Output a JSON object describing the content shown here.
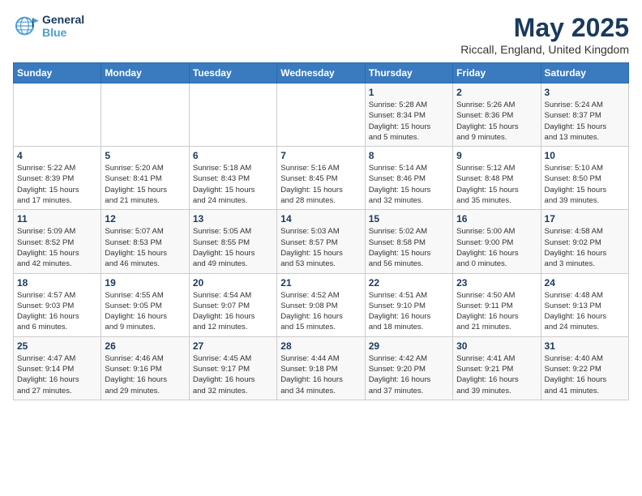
{
  "logo": {
    "line1": "General",
    "line2": "Blue"
  },
  "title": "May 2025",
  "subtitle": "Riccall, England, United Kingdom",
  "weekdays": [
    "Sunday",
    "Monday",
    "Tuesday",
    "Wednesday",
    "Thursday",
    "Friday",
    "Saturday"
  ],
  "weeks": [
    [
      {
        "day": "",
        "info": ""
      },
      {
        "day": "",
        "info": ""
      },
      {
        "day": "",
        "info": ""
      },
      {
        "day": "",
        "info": ""
      },
      {
        "day": "1",
        "info": "Sunrise: 5:28 AM\nSunset: 8:34 PM\nDaylight: 15 hours\nand 5 minutes."
      },
      {
        "day": "2",
        "info": "Sunrise: 5:26 AM\nSunset: 8:36 PM\nDaylight: 15 hours\nand 9 minutes."
      },
      {
        "day": "3",
        "info": "Sunrise: 5:24 AM\nSunset: 8:37 PM\nDaylight: 15 hours\nand 13 minutes."
      }
    ],
    [
      {
        "day": "4",
        "info": "Sunrise: 5:22 AM\nSunset: 8:39 PM\nDaylight: 15 hours\nand 17 minutes."
      },
      {
        "day": "5",
        "info": "Sunrise: 5:20 AM\nSunset: 8:41 PM\nDaylight: 15 hours\nand 21 minutes."
      },
      {
        "day": "6",
        "info": "Sunrise: 5:18 AM\nSunset: 8:43 PM\nDaylight: 15 hours\nand 24 minutes."
      },
      {
        "day": "7",
        "info": "Sunrise: 5:16 AM\nSunset: 8:45 PM\nDaylight: 15 hours\nand 28 minutes."
      },
      {
        "day": "8",
        "info": "Sunrise: 5:14 AM\nSunset: 8:46 PM\nDaylight: 15 hours\nand 32 minutes."
      },
      {
        "day": "9",
        "info": "Sunrise: 5:12 AM\nSunset: 8:48 PM\nDaylight: 15 hours\nand 35 minutes."
      },
      {
        "day": "10",
        "info": "Sunrise: 5:10 AM\nSunset: 8:50 PM\nDaylight: 15 hours\nand 39 minutes."
      }
    ],
    [
      {
        "day": "11",
        "info": "Sunrise: 5:09 AM\nSunset: 8:52 PM\nDaylight: 15 hours\nand 42 minutes."
      },
      {
        "day": "12",
        "info": "Sunrise: 5:07 AM\nSunset: 8:53 PM\nDaylight: 15 hours\nand 46 minutes."
      },
      {
        "day": "13",
        "info": "Sunrise: 5:05 AM\nSunset: 8:55 PM\nDaylight: 15 hours\nand 49 minutes."
      },
      {
        "day": "14",
        "info": "Sunrise: 5:03 AM\nSunset: 8:57 PM\nDaylight: 15 hours\nand 53 minutes."
      },
      {
        "day": "15",
        "info": "Sunrise: 5:02 AM\nSunset: 8:58 PM\nDaylight: 15 hours\nand 56 minutes."
      },
      {
        "day": "16",
        "info": "Sunrise: 5:00 AM\nSunset: 9:00 PM\nDaylight: 16 hours\nand 0 minutes."
      },
      {
        "day": "17",
        "info": "Sunrise: 4:58 AM\nSunset: 9:02 PM\nDaylight: 16 hours\nand 3 minutes."
      }
    ],
    [
      {
        "day": "18",
        "info": "Sunrise: 4:57 AM\nSunset: 9:03 PM\nDaylight: 16 hours\nand 6 minutes."
      },
      {
        "day": "19",
        "info": "Sunrise: 4:55 AM\nSunset: 9:05 PM\nDaylight: 16 hours\nand 9 minutes."
      },
      {
        "day": "20",
        "info": "Sunrise: 4:54 AM\nSunset: 9:07 PM\nDaylight: 16 hours\nand 12 minutes."
      },
      {
        "day": "21",
        "info": "Sunrise: 4:52 AM\nSunset: 9:08 PM\nDaylight: 16 hours\nand 15 minutes."
      },
      {
        "day": "22",
        "info": "Sunrise: 4:51 AM\nSunset: 9:10 PM\nDaylight: 16 hours\nand 18 minutes."
      },
      {
        "day": "23",
        "info": "Sunrise: 4:50 AM\nSunset: 9:11 PM\nDaylight: 16 hours\nand 21 minutes."
      },
      {
        "day": "24",
        "info": "Sunrise: 4:48 AM\nSunset: 9:13 PM\nDaylight: 16 hours\nand 24 minutes."
      }
    ],
    [
      {
        "day": "25",
        "info": "Sunrise: 4:47 AM\nSunset: 9:14 PM\nDaylight: 16 hours\nand 27 minutes."
      },
      {
        "day": "26",
        "info": "Sunrise: 4:46 AM\nSunset: 9:16 PM\nDaylight: 16 hours\nand 29 minutes."
      },
      {
        "day": "27",
        "info": "Sunrise: 4:45 AM\nSunset: 9:17 PM\nDaylight: 16 hours\nand 32 minutes."
      },
      {
        "day": "28",
        "info": "Sunrise: 4:44 AM\nSunset: 9:18 PM\nDaylight: 16 hours\nand 34 minutes."
      },
      {
        "day": "29",
        "info": "Sunrise: 4:42 AM\nSunset: 9:20 PM\nDaylight: 16 hours\nand 37 minutes."
      },
      {
        "day": "30",
        "info": "Sunrise: 4:41 AM\nSunset: 9:21 PM\nDaylight: 16 hours\nand 39 minutes."
      },
      {
        "day": "31",
        "info": "Sunrise: 4:40 AM\nSunset: 9:22 PM\nDaylight: 16 hours\nand 41 minutes."
      }
    ]
  ]
}
